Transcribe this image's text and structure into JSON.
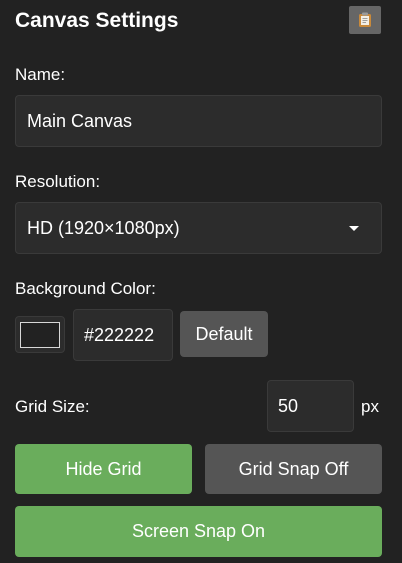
{
  "panel": {
    "title": "Canvas Settings",
    "icon": "clipboard-icon"
  },
  "name": {
    "label": "Name:",
    "value": "Main Canvas"
  },
  "resolution": {
    "label": "Resolution:",
    "selected": "HD (1920×1080px)"
  },
  "background": {
    "label": "Background Color:",
    "value": "#222222",
    "swatch_color": "#222222",
    "default_label": "Default"
  },
  "grid": {
    "label": "Grid Size:",
    "value": "50",
    "unit": "px"
  },
  "buttons": {
    "hide_grid": "Hide Grid",
    "grid_snap": "Grid Snap Off",
    "screen_snap": "Screen Snap On"
  },
  "colors": {
    "background": "#222222",
    "field": "#2c2c2c",
    "gray_button": "#555555",
    "green_button": "#6aad5c",
    "icon_button": "#666666"
  }
}
